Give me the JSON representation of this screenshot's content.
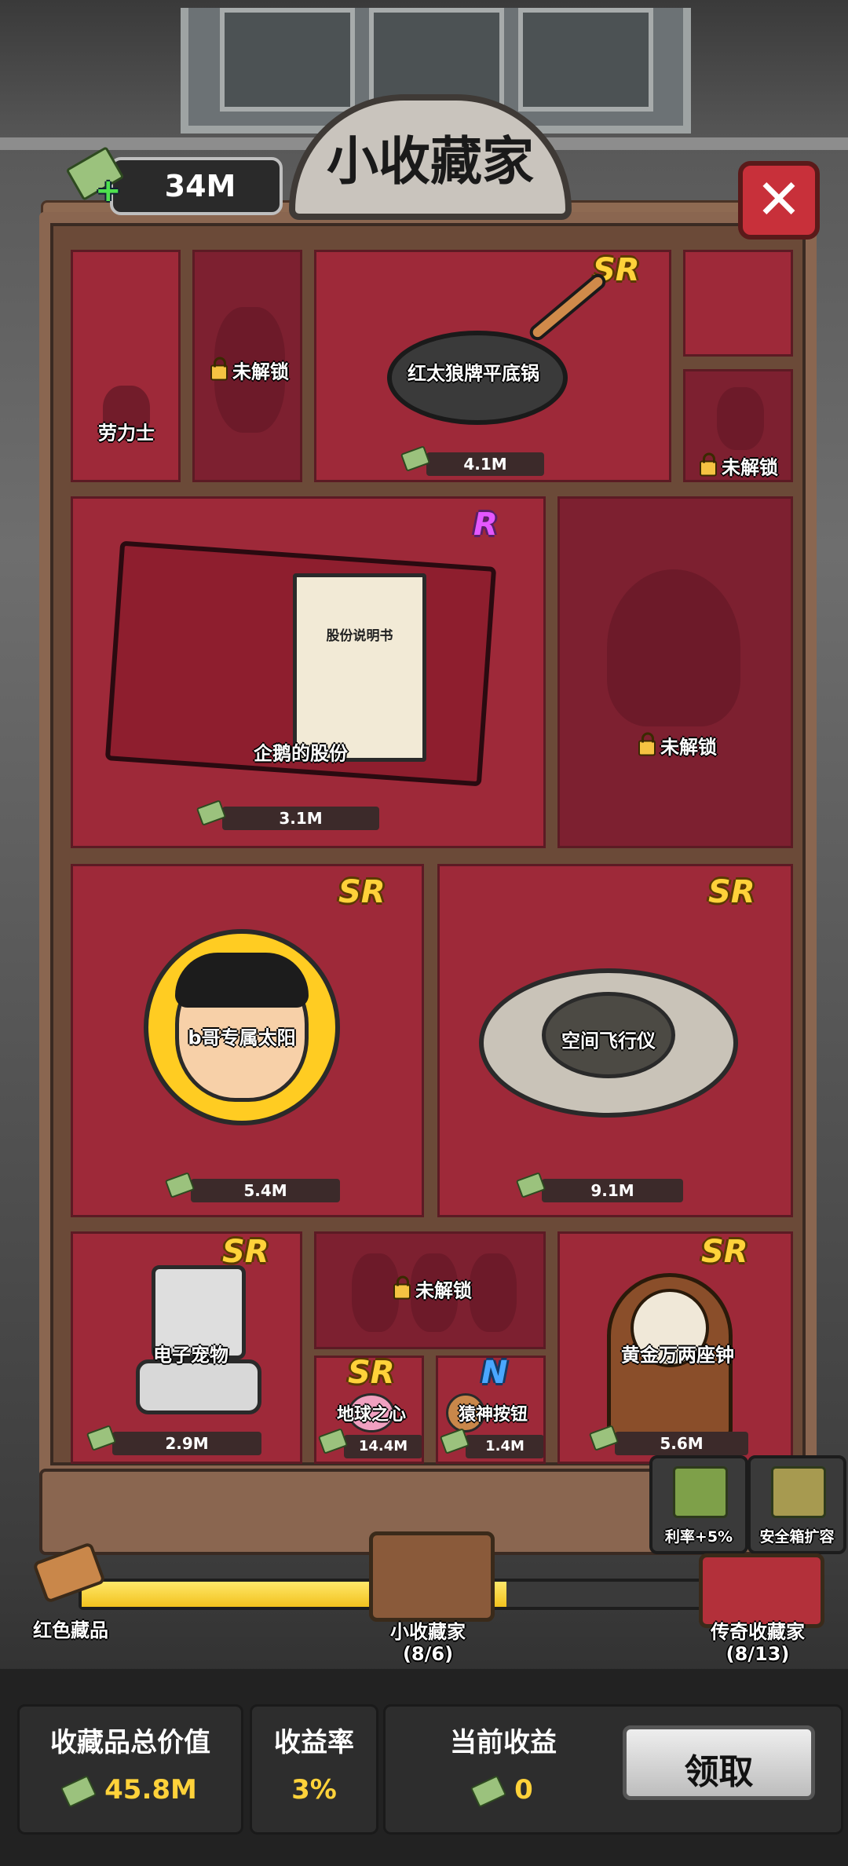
{
  "header": {
    "money": "34M",
    "title": "小收藏家",
    "close_icon": "✕"
  },
  "items": [
    {
      "name": "劳力士",
      "locked": false
    },
    {
      "name": "未解锁",
      "locked": true
    },
    {
      "name": "红太狼牌平底锅",
      "rarity": "SR",
      "price": "4.1M"
    },
    {
      "name": "未解锁",
      "locked": true
    },
    {
      "name": "企鹅的股份",
      "rarity": "R",
      "price": "3.1M",
      "document_text": "股份说明书"
    },
    {
      "name": "未解锁",
      "locked": true
    },
    {
      "name": "b哥专属太阳",
      "rarity": "SR",
      "price": "5.4M"
    },
    {
      "name": "空间飞行仪",
      "rarity": "SR",
      "price": "9.1M"
    },
    {
      "name": "电子宠物",
      "rarity": "SR",
      "price": "2.9M"
    },
    {
      "name": "未解锁",
      "locked": true
    },
    {
      "name": "黄金万两座钟",
      "rarity": "SR",
      "price": "5.6M"
    },
    {
      "name": "地球之心",
      "rarity": "SR",
      "price": "14.4M"
    },
    {
      "name": "猿神按钮",
      "rarity": "N",
      "price": "1.4M"
    }
  ],
  "side_buttons": {
    "rate": "利率+5%",
    "safe": "安全箱扩容"
  },
  "progress": {
    "fill_fraction": 0.62,
    "left_label": "红色藏品",
    "middle_label": "小收藏家",
    "middle_count": "(8/6)",
    "right_label": "传奇收藏家",
    "right_count": "(8/13)"
  },
  "stats": {
    "total_value_title": "收藏品总价值",
    "total_value": "45.8M",
    "rate_title": "收益率",
    "rate_value": "3%",
    "income_title": "当前收益",
    "income_value": "0",
    "claim_label": "领取"
  },
  "colors": {
    "cell_red": "#9e2939",
    "gold_badge": "#ffd23a",
    "progress_yellow": "#f2c21e"
  }
}
